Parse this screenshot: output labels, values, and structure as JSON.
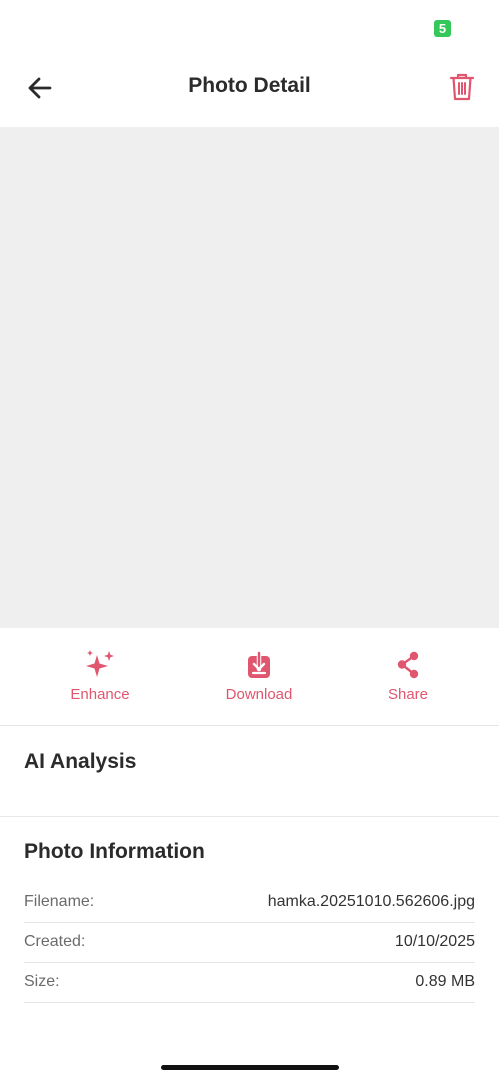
{
  "status_bar": {
    "badge_text": "5"
  },
  "header": {
    "title": "Photo Detail",
    "back_icon": "arrow-left-icon",
    "delete_icon": "trash-icon"
  },
  "actions": [
    {
      "label": "Enhance",
      "icon": "sparkles-icon"
    },
    {
      "label": "Download",
      "icon": "download-icon"
    },
    {
      "label": "Share",
      "icon": "share-icon"
    }
  ],
  "ai_analysis": {
    "title": "AI Analysis"
  },
  "photo_information": {
    "title": "Photo Information",
    "rows": [
      {
        "key": "Filename:",
        "value": "hamka.20251010.562606.jpg"
      },
      {
        "key": "Created:",
        "value": "10/10/2025"
      },
      {
        "key": "Size:",
        "value": "0.89 MB"
      }
    ]
  },
  "colors": {
    "accent": "#e0566f",
    "status_badge": "#34c759",
    "preview_background": "#efefef"
  }
}
